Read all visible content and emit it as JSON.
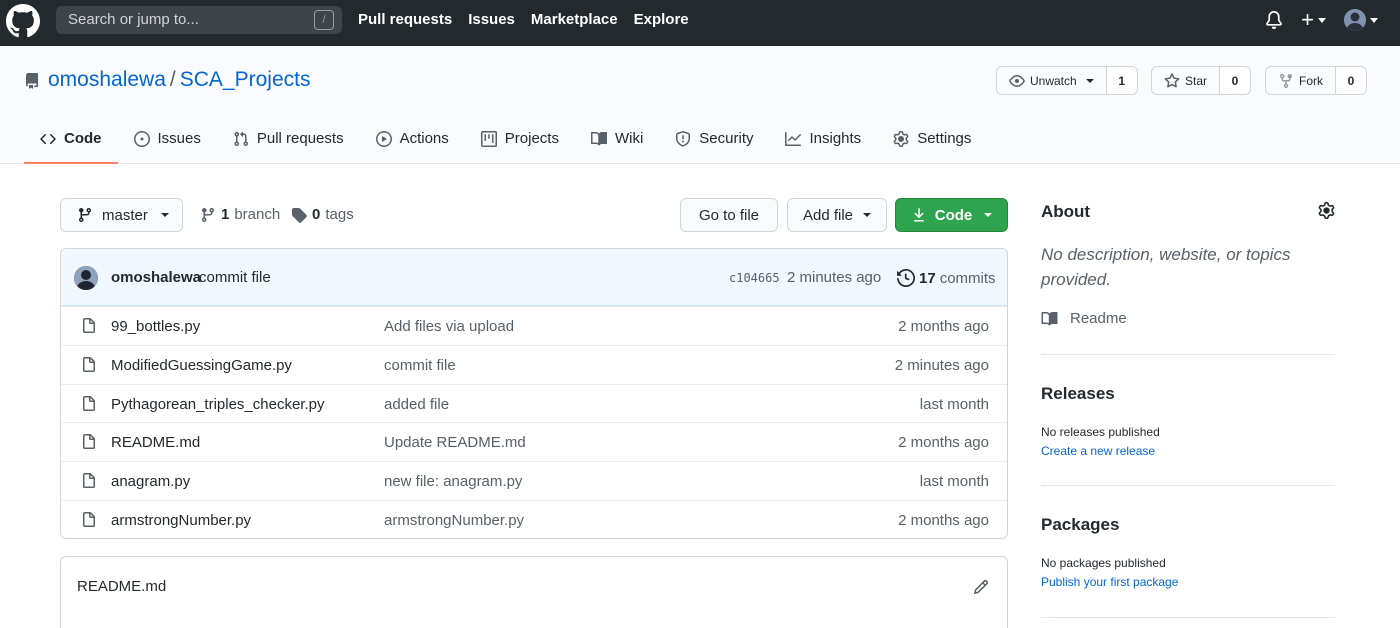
{
  "header": {
    "search_placeholder": "Search or jump to...",
    "search_shortcut": "/",
    "nav": [
      "Pull requests",
      "Issues",
      "Marketplace",
      "Explore"
    ],
    "plus_label": "+"
  },
  "repo": {
    "owner": "omoshalewa",
    "separator": "/",
    "name": "SCA_Projects",
    "watch_label": "Unwatch",
    "watch_count": "1",
    "star_label": "Star",
    "star_count": "0",
    "fork_label": "Fork",
    "fork_count": "0"
  },
  "tabs": [
    {
      "label": "Code",
      "icon": "code-icon",
      "selected": true
    },
    {
      "label": "Issues",
      "icon": "issue-icon"
    },
    {
      "label": "Pull requests",
      "icon": "pull-request-icon"
    },
    {
      "label": "Actions",
      "icon": "play-icon"
    },
    {
      "label": "Projects",
      "icon": "project-icon"
    },
    {
      "label": "Wiki",
      "icon": "book-icon"
    },
    {
      "label": "Security",
      "icon": "shield-icon"
    },
    {
      "label": "Insights",
      "icon": "graph-icon"
    },
    {
      "label": "Settings",
      "icon": "gear-icon"
    }
  ],
  "toolbar": {
    "branch": "master",
    "branch_count": "1",
    "branch_word": "branch",
    "tag_count": "0",
    "tag_word": "tags",
    "go_to_file": "Go to file",
    "add_file": "Add file",
    "code": "Code"
  },
  "commit": {
    "author": "omoshalewa",
    "message": "commit file",
    "sha": "c104665",
    "time": "2 minutes ago",
    "count": "17",
    "count_word": "commits"
  },
  "files": [
    {
      "name": "99_bottles.py",
      "message": "Add files via upload",
      "age": "2 months ago"
    },
    {
      "name": "ModifiedGuessingGame.py",
      "message": "commit file",
      "age": "2 minutes ago"
    },
    {
      "name": "Pythagorean_triples_checker.py",
      "message": "added file",
      "age": "last month"
    },
    {
      "name": "README.md",
      "message": "Update README.md",
      "age": "2 months ago"
    },
    {
      "name": "anagram.py",
      "message": "new file: anagram.py",
      "age": "last month"
    },
    {
      "name": "armstrongNumber.py",
      "message": "armstrongNumber.py",
      "age": "2 months ago"
    }
  ],
  "readme": {
    "title": "README.md"
  },
  "sidebar": {
    "about_title": "About",
    "about_desc": "No description, website, or topics provided.",
    "readme_link": "Readme",
    "releases_title": "Releases",
    "releases_empty": "No releases published",
    "releases_link": "Create a new release",
    "packages_title": "Packages",
    "packages_empty": "No packages published",
    "packages_link": "Publish your first package"
  },
  "colors": {
    "header_bg": "#24292e",
    "link": "#0366d6",
    "code_button": "#2ea44f",
    "selected_tab_underline": "#f9826c",
    "commit_bar_bg": "#f1f8ff"
  }
}
